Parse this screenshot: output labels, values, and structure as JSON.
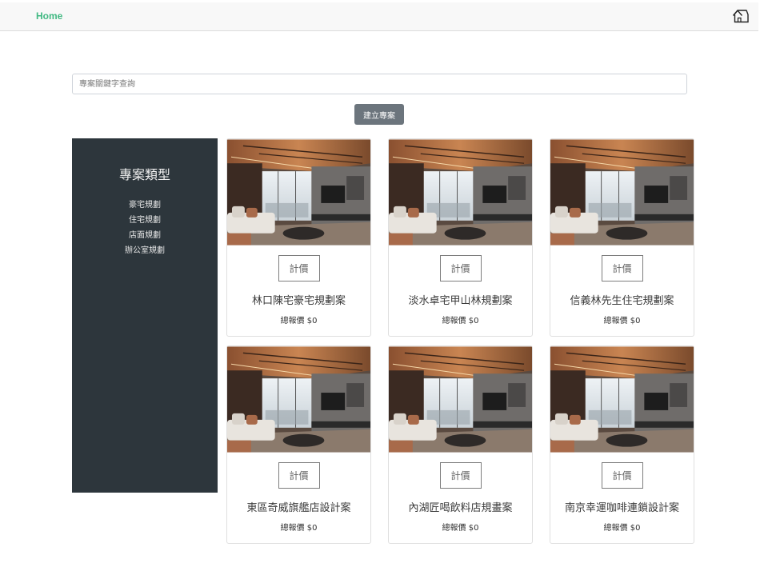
{
  "nav": {
    "home_label": "Home",
    "icon": "house-icon",
    "accent": "#42b983"
  },
  "search": {
    "placeholder": "專案關鍵字查詢"
  },
  "create_button": {
    "label": "建立專案"
  },
  "sidebar": {
    "title": "專案類型",
    "items": [
      {
        "label": "豪宅規劃"
      },
      {
        "label": "住宅規劃"
      },
      {
        "label": "店面規劃"
      },
      {
        "label": "辦公室規劃"
      }
    ]
  },
  "projects": [
    {
      "name": "林口陳宅豪宅規劃案",
      "button": "計價",
      "price": "總報價 $0"
    },
    {
      "name": "淡水卓宅甲山林規劃案",
      "button": "計價",
      "price": "總報價 $0"
    },
    {
      "name": "信義林先生住宅規劃案",
      "button": "計價",
      "price": "總報價 $0"
    },
    {
      "name": "東區奇威旗艦店設計案",
      "button": "計價",
      "price": "總報價 $0"
    },
    {
      "name": "內湖匠喝飲料店規畫案",
      "button": "計價",
      "price": "總報價 $0"
    },
    {
      "name": "南京幸運咖啡連鎖設計案",
      "button": "計價",
      "price": "總報價 $0"
    }
  ]
}
